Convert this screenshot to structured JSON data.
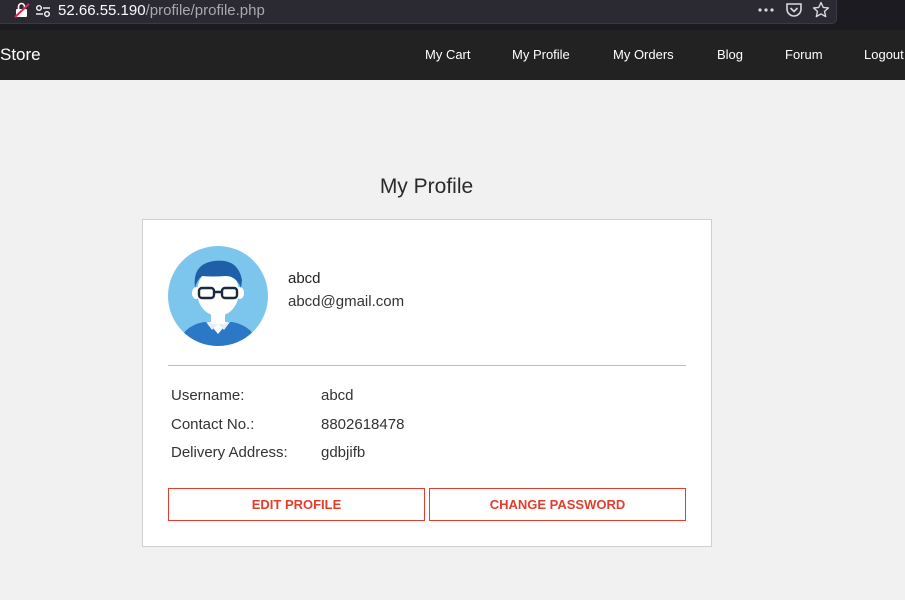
{
  "browser": {
    "url_host": "52.66.55.190",
    "url_path": "/profile/profile.php",
    "icons": [
      "insecure-lock-icon",
      "permissions-icon",
      "more-icon",
      "pocket-icon",
      "bookmark-star-icon"
    ]
  },
  "navbar": {
    "brand": "Store",
    "items": [
      "My Cart",
      "My Profile",
      "My Orders",
      "Blog",
      "Forum",
      "Logout"
    ]
  },
  "page": {
    "title": "My Profile"
  },
  "profile": {
    "name": "abcd",
    "email": "abcd@gmail.com",
    "details": [
      {
        "label": "Username:",
        "value": "abcd"
      },
      {
        "label": "Contact No.:",
        "value": "8802618478"
      },
      {
        "label": "Delivery Address:",
        "value": "gdbjifb"
      }
    ],
    "buttons": {
      "edit": "EDIT PROFILE",
      "change_password": "CHANGE PASSWORD"
    }
  },
  "colors": {
    "accent": "#e23d2d",
    "navbar_bg": "#222222",
    "page_bg": "#f1f1f1",
    "avatar_bg": "#7cc5ec"
  }
}
